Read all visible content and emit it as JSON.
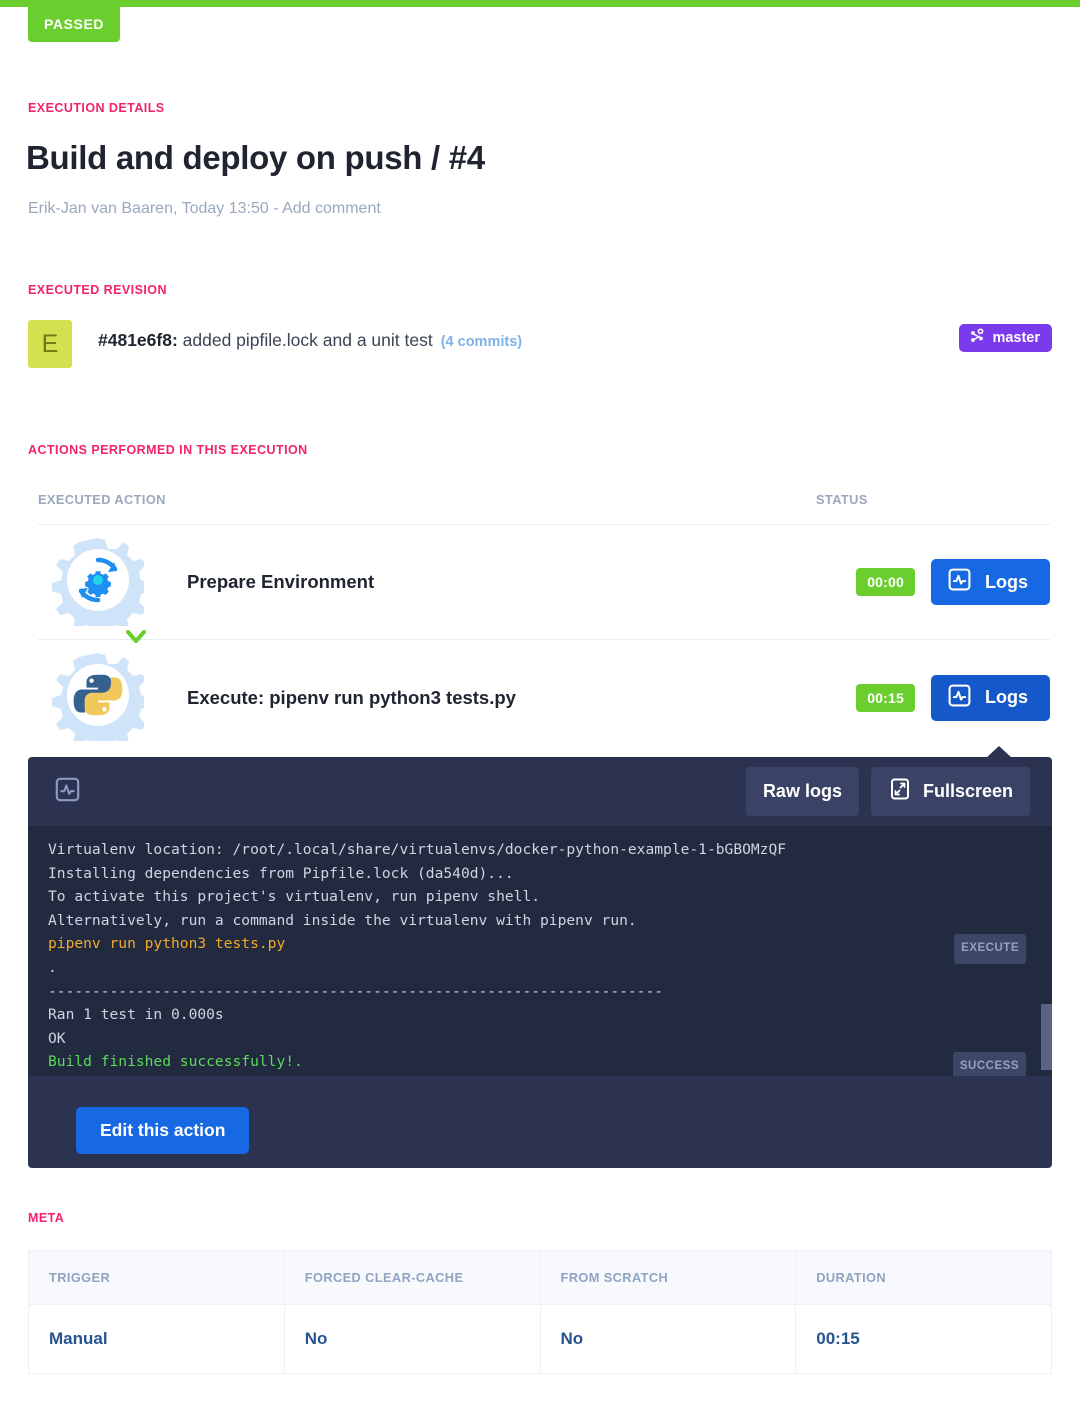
{
  "status_bar": {
    "label": "PASSED",
    "color": "#6ace2e"
  },
  "sections": {
    "execution_details": "EXECUTION DETAILS",
    "executed_revision": "EXECUTED REVISION",
    "actions_performed": "ACTIONS PERFORMED IN THIS EXECUTION",
    "meta": "META"
  },
  "header": {
    "title": "Build and deploy on push / #4",
    "author": "Erik-Jan van Baaren, Today 13:50 - ",
    "add_comment": "Add comment"
  },
  "revision": {
    "avatar_initial": "E",
    "sha": "#481e6f8:",
    "message": " added pipfile.lock and a unit test",
    "commits": "(4 commits)",
    "branch": "master",
    "branch_icon": "git-branch-icon",
    "branch_color": "#7c3aed"
  },
  "actions_table": {
    "columns": {
      "action": "EXECUTED ACTION",
      "status": "STATUS"
    },
    "rows": [
      {
        "icon": "gear-refresh-icon",
        "name": "Prepare Environment",
        "duration": "00:00",
        "logs_label": "Logs",
        "logs_icon": "pulse-icon",
        "active": false
      },
      {
        "icon": "python-icon",
        "name": "Execute: pipenv run python3 tests.py",
        "duration": "00:15",
        "logs_label": "Logs",
        "logs_icon": "pulse-icon",
        "active": true
      }
    ]
  },
  "log_panel": {
    "panel_icon": "pulse-icon",
    "raw_logs_label": "Raw logs",
    "fullscreen_label": "Fullscreen",
    "fullscreen_icon": "expand-icon",
    "edit_label": "Edit this action",
    "lines": [
      {
        "text": "Virtualenv location: /root/.local/share/virtualenvs/docker-python-example-1-bGBOMzQF",
        "style": "plain",
        "tag": ""
      },
      {
        "text": "Installing dependencies from Pipfile.lock (da540d)...",
        "style": "plain",
        "tag": ""
      },
      {
        "text": "To activate this project's virtualenv, run pipenv shell.",
        "style": "plain",
        "tag": ""
      },
      {
        "text": "Alternatively, run a command inside the virtualenv with pipenv run.",
        "style": "plain",
        "tag": ""
      },
      {
        "text": "pipenv run python3 tests.py",
        "style": "cmd",
        "tag": "EXECUTE"
      },
      {
        "text": ".",
        "style": "plain",
        "tag": ""
      },
      {
        "text": "----------------------------------------------------------------------",
        "style": "plain",
        "tag": ""
      },
      {
        "text": "Ran 1 test in 0.000s",
        "style": "plain",
        "tag": ""
      },
      {
        "text": "OK",
        "style": "plain",
        "tag": ""
      },
      {
        "text": "Build finished successfully!.",
        "style": "ok",
        "tag": "SUCCESS"
      }
    ]
  },
  "meta_table": {
    "columns": [
      "TRIGGER",
      "FORCED CLEAR-CACHE",
      "FROM SCRATCH",
      "DURATION"
    ],
    "values": [
      "Manual",
      "No",
      "No",
      "00:15"
    ]
  }
}
